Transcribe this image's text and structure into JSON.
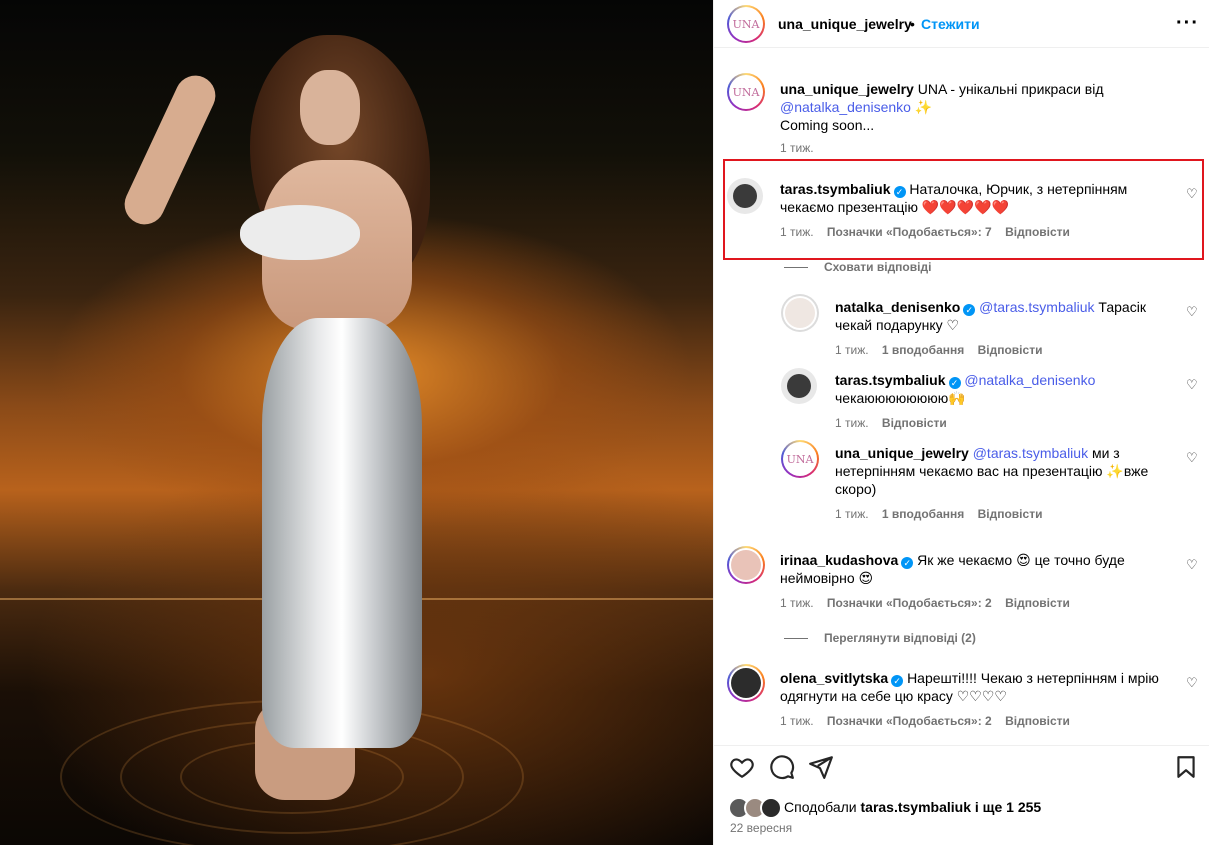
{
  "post": {
    "author": "una_unique_jewelry",
    "follow_label": "Стежити",
    "avatar_text": "UNA",
    "caption_text": "UNA - унікальні прикраси від",
    "caption_mention": "@natalka_denisenko",
    "caption_line2": "Coming soon...",
    "caption_time": "1 тиж."
  },
  "comments": [
    {
      "user": "taras.tsymbaliuk",
      "text_line1": "Наталочка, Юрчик, з нетерпінням",
      "text_line2": "чекаємо презентацію ❤️❤️❤️❤️❤️",
      "time": "1 тиж.",
      "likes": "Позначки «Подобається»: 7",
      "reply": "Відповісти"
    },
    {
      "user": "irinaa_kudashova",
      "text_line1": "Як же чекаємо 😍 це точно буде",
      "text_line2": "неймовірно 😍",
      "time": "1 тиж.",
      "likes": "Позначки «Подобається»: 2",
      "reply": "Відповісти",
      "view_replies": "Переглянути відповіді (2)"
    },
    {
      "user": "olena_svitlytska",
      "text_line1": "Нарешті!!!! Чекаю з нетерпінням і мрію",
      "text_line2": "одягнути на себе цю красу ♡♡♡♡",
      "time": "1 тиж.",
      "likes": "Позначки «Подобається»: 2",
      "reply": "Відповісти"
    }
  ],
  "hide_replies": "Сховати відповіді",
  "replies": [
    {
      "user": "natalka_denisenko",
      "mention": "@taras.tsymbaliuk",
      "text_line1": "Тарасік",
      "text_line2": "чекай подарунку ♡",
      "time": "1 тиж.",
      "likes": "1 вподобання",
      "reply": "Відповісти"
    },
    {
      "user": "taras.tsymbaliuk",
      "mention": "@natalka_denisenko",
      "text_line1": "",
      "text_line2": "чекаюююююююю🙌",
      "time": "1 тиж.",
      "likes": "",
      "reply": "Відповісти"
    },
    {
      "user": "una_unique_jewelry",
      "mention": "@taras.tsymbaliuk",
      "text_line1": "ми з",
      "text_line2": "нетерпінням чекаємо вас на презентацію ✨вже",
      "text_line3": "скоро)",
      "time": "1 тиж.",
      "likes": "1 вподобання",
      "reply": "Відповісти"
    }
  ],
  "footer": {
    "liked_by_prefix": "Сподобали",
    "liked_by_user": "taras.tsymbaliuk",
    "liked_by_suffix": "і ще 1 255",
    "date": "22 вересня"
  },
  "colors": {
    "accent_link": "#4a5de8",
    "verified": "#0095f6",
    "highlight_box": "#e0161e"
  }
}
